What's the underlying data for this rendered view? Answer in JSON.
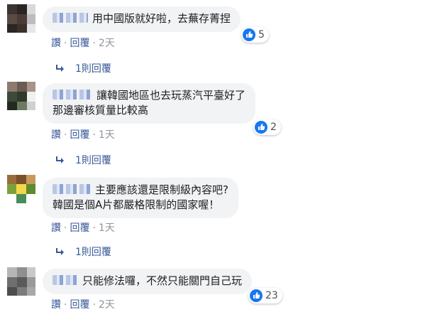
{
  "accent": "#385898",
  "like_color": "#1877f2",
  "comments": [
    {
      "text": "用中國版就好啦，去蕪存菁捏",
      "reactions": "5",
      "actions": {
        "like": "讚",
        "reply": "回覆",
        "time": "2天"
      },
      "replies": "1則回覆",
      "avatar_icon": "pixelated-avatar"
    },
    {
      "text_lines": [
        "讓韓國地區也去玩蒸汽平臺好了",
        "那邊審核質量比較高"
      ],
      "reactions": "2",
      "actions": {
        "like": "讚",
        "reply": "回覆",
        "time": "1天"
      },
      "replies": "1則回覆",
      "avatar_icon": "pixelated-avatar"
    },
    {
      "text_lines": [
        "主要應該還是限制級內容吧?",
        "韓國是個A片都嚴格限制的國家喔！"
      ],
      "actions": {
        "like": "讚",
        "reply": "回覆",
        "time": "1天"
      },
      "replies": "1則回覆",
      "avatar_icon": "pixelated-avatar"
    },
    {
      "text": "只能修法囉，不然只能關門自己玩",
      "reactions": "23",
      "actions": {
        "like": "讚",
        "reply": "回覆",
        "time": "2天"
      },
      "avatar_icon": "pixelated-avatar"
    }
  ]
}
